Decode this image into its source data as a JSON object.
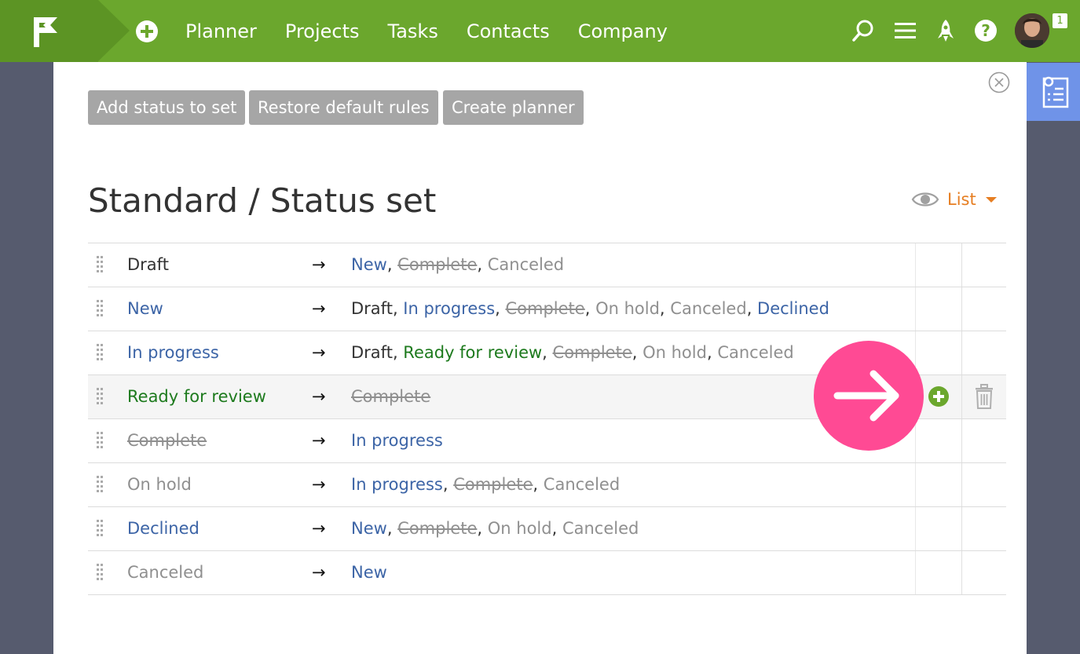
{
  "nav": {
    "items": [
      "Planner",
      "Projects",
      "Tasks",
      "Contacts",
      "Company"
    ],
    "notification_count": "1",
    "icons": [
      "logo-flag-icon",
      "add-icon",
      "search-icon",
      "menu-icon",
      "rocket-icon",
      "help-icon"
    ]
  },
  "toolbar": {
    "add_status": "Add status to set",
    "restore_rules": "Restore default rules",
    "create_planner": "Create planner"
  },
  "page": {
    "title": "Standard / Status set",
    "view_label": "List"
  },
  "arrow_symbol": "→",
  "colors": {
    "topbar": "#6ba72d",
    "accent_orange": "#e67e22",
    "link_blue": "#3c64a6",
    "ready_green": "#1d7a1d",
    "muted_gray": "#8f8f8f",
    "pointer_pink": "#ff4a94",
    "sidebar_tab": "#6f93e8"
  },
  "rows": [
    {
      "status": {
        "label": "Draft",
        "style": "black"
      },
      "targets": [
        {
          "label": "New",
          "style": "blue"
        },
        {
          "label": "Complete",
          "style": "strike"
        },
        {
          "label": "Canceled",
          "style": "gray"
        }
      ]
    },
    {
      "status": {
        "label": "New",
        "style": "blue"
      },
      "targets": [
        {
          "label": "Draft",
          "style": "black"
        },
        {
          "label": "In progress",
          "style": "blue"
        },
        {
          "label": "Complete",
          "style": "strike"
        },
        {
          "label": "On hold",
          "style": "gray"
        },
        {
          "label": "Canceled",
          "style": "gray"
        },
        {
          "label": "Declined",
          "style": "blue"
        }
      ]
    },
    {
      "status": {
        "label": "In progress",
        "style": "blue"
      },
      "targets": [
        {
          "label": "Draft",
          "style": "black"
        },
        {
          "label": "Ready for review",
          "style": "green"
        },
        {
          "label": "Complete",
          "style": "strike"
        },
        {
          "label": "On hold",
          "style": "gray"
        },
        {
          "label": "Canceled",
          "style": "gray"
        }
      ]
    },
    {
      "status": {
        "label": "Ready for review",
        "style": "green"
      },
      "highlighted": true,
      "targets": [
        {
          "label": "Complete",
          "style": "strike"
        }
      ]
    },
    {
      "status": {
        "label": "Complete",
        "style": "strike"
      },
      "targets": [
        {
          "label": "In progress",
          "style": "blue"
        }
      ]
    },
    {
      "status": {
        "label": "On hold",
        "style": "gray"
      },
      "targets": [
        {
          "label": "In progress",
          "style": "blue"
        },
        {
          "label": "Complete",
          "style": "strike"
        },
        {
          "label": "Canceled",
          "style": "gray"
        }
      ]
    },
    {
      "status": {
        "label": "Declined",
        "style": "blue"
      },
      "targets": [
        {
          "label": "New",
          "style": "blue"
        },
        {
          "label": "Complete",
          "style": "strike"
        },
        {
          "label": "On hold",
          "style": "gray"
        },
        {
          "label": "Canceled",
          "style": "gray"
        }
      ]
    },
    {
      "status": {
        "label": "Canceled",
        "style": "gray"
      },
      "targets": [
        {
          "label": "New",
          "style": "blue"
        }
      ]
    }
  ]
}
